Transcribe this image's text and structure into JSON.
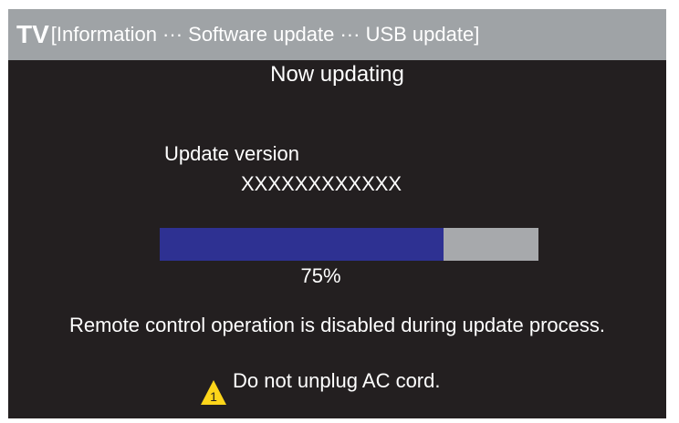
{
  "title_bar": {
    "brand": "TV",
    "path": "[Information ··· Software update ··· USB update]"
  },
  "main": {
    "heading": "Now updating",
    "version_label": "Update version",
    "version_value": "XXXXXXXXXXXX",
    "progress": {
      "value": 0.75,
      "label": "75%"
    },
    "notice": "Remote control operation is disabled during update process.",
    "warning": {
      "icon": "warning-triangle-icon",
      "icon_number": "1",
      "text": "Do not unplug AC cord."
    }
  },
  "colors": {
    "screen_background": "#231f20",
    "title_bar_background": "#9fa3a6",
    "progress_fill": "#2e3192",
    "progress_track": "#a7a9ac",
    "warning_icon": "#fdd51a"
  }
}
